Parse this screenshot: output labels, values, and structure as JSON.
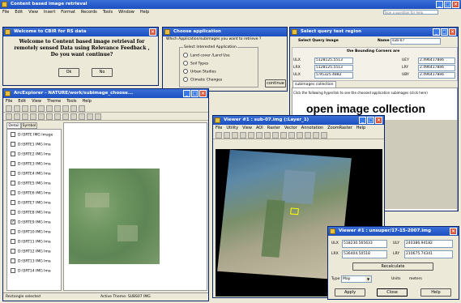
{
  "main": {
    "title": "Content based image retrieval",
    "menu": [
      "File",
      "Edit",
      "View",
      "Insert",
      "Format",
      "Records",
      "Tools",
      "Window",
      "Help"
    ],
    "search_placeholder": "Type a question for help"
  },
  "welcome": {
    "title": "Welcome to CBIR for RS data",
    "message": "Welcome to Content based image retrieval for remotely sensed Data using Relevance Feedback , Do you want continue?",
    "ok": "Ok",
    "no": "No"
  },
  "choose": {
    "title": "Choose application",
    "question": "Which Application/subimages you want to retrieve ?",
    "group_title": "Select Interested Application",
    "options": [
      "Land cover /Land Use",
      "Soil Types",
      "Urban Studies",
      "Climatic Changes"
    ],
    "continue": "continue"
  },
  "query": {
    "title": "Select query test region",
    "sq_label": "Select Query Image",
    "name_label": "Name",
    "name_value": "sub-07",
    "bounding_title": "the Bounding Corners are",
    "rows": [
      {
        "l": "ULX",
        "v1": "5128125.5513",
        "r": "UEY",
        "v2": "2.4964178e6"
      },
      {
        "l": "LRX",
        "v1": "5128125.5513",
        "r": "LRY",
        "v2": "2.4964178e6"
      },
      {
        "l": "ULX",
        "v1": "5.95325.4882",
        "r": "UBY",
        "v2": "2.4964178e6"
      }
    ],
    "tab": "subimages collection",
    "instruction": "Click the following hyperlink to see the choosed application subimages (click here)",
    "link": "open image collection"
  },
  "arc": {
    "title": "ArcExplorer - NATURE/work/subimage_choose...",
    "menu": [
      "File",
      "Edit",
      "View",
      "Theme",
      "Tools",
      "Help"
    ],
    "tabs": [
      "Detail",
      "Symbol"
    ],
    "layers": [
      {
        "label": "D:\\SRTE IMG Image",
        "checked": false
      },
      {
        "label": "D:\\SRTE1 IMG Ima",
        "checked": false
      },
      {
        "label": "D:\\SRTE2 IMG Ima",
        "checked": false
      },
      {
        "label": "D:\\SRTE3 IMG Ima",
        "checked": false
      },
      {
        "label": "D:\\SRTE4 IMG Ima",
        "checked": false
      },
      {
        "label": "D:\\SRTE5 IMG Ima",
        "checked": false
      },
      {
        "label": "D:\\SRTE6 IMG Ima",
        "checked": false
      },
      {
        "label": "D:\\SRTE7 IMG Ima",
        "checked": false
      },
      {
        "label": "D:\\SRTE8 IMG Ima",
        "checked": false
      },
      {
        "label": "D:\\SRTE9 IMG Ima",
        "checked": true
      },
      {
        "label": "D:\\SRT10 IMG Ima",
        "checked": false
      },
      {
        "label": "D:\\SRT11 IMG Ima",
        "checked": false
      },
      {
        "label": "D:\\SRT12 IMG Ima",
        "checked": false
      },
      {
        "label": "D:\\SRT13 IMG Ima",
        "checked": false
      },
      {
        "label": "D:\\SRT14 IMG Ima",
        "checked": false
      }
    ],
    "status_left": "Rectangle selected",
    "status_mid": "Active Theme: SUBS07 IMG"
  },
  "viewer1": {
    "title": "Viewer #1 : sub-07.img (:Layer_1)",
    "menu": [
      "File",
      "Utility",
      "View",
      "AOI",
      "Raster",
      "Vector",
      "Annotation",
      "ZoomRaster",
      "Help"
    ]
  },
  "viewer2": {
    "title": "Viewer #1 : unsuper/17-15-2007.img",
    "ulx_label": "ULX",
    "ulx": "518230.565633",
    "uly_label": "ULY",
    "uly": "240386.94182",
    "lrx_label": "LRX",
    "lrx": "536404.50518",
    "lry_label": "LRY",
    "lry": "210675.74341",
    "recalc": "Recalculate",
    "type_label": "Type",
    "type_value": "Map",
    "units_label": "Units",
    "units_value": "meters",
    "apply": "Apply",
    "close": "Close",
    "help": "Help"
  }
}
